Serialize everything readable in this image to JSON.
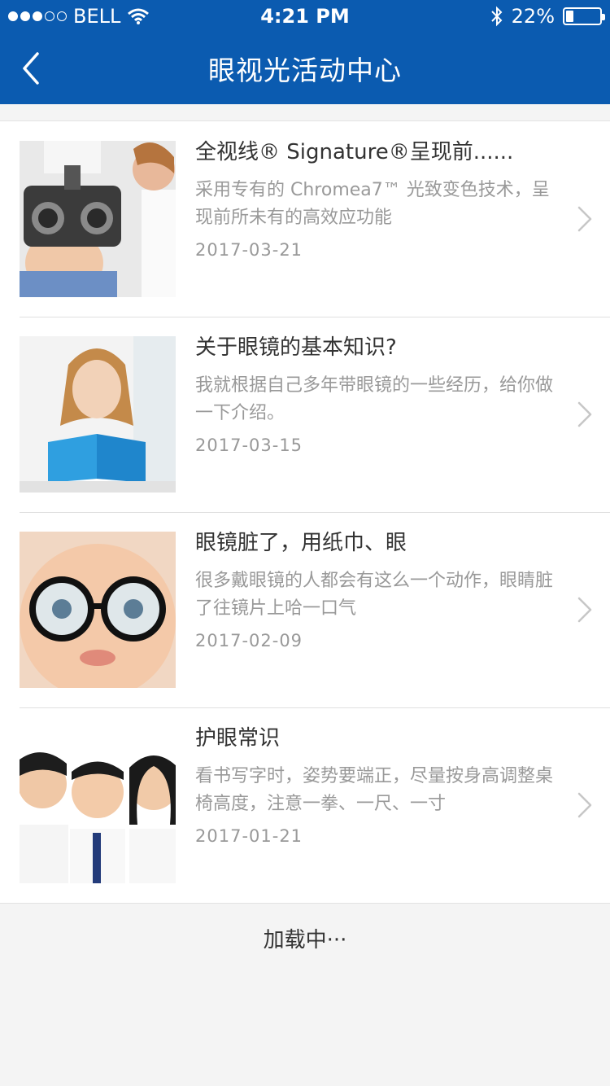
{
  "status": {
    "carrier": "BELL",
    "time": "4:21 PM",
    "battery": "22%",
    "battery_level": 0.22
  },
  "nav": {
    "title": "眼视光活动中心"
  },
  "articles": [
    {
      "title": "全视线® Signature®呈现前......",
      "desc": "采用专有的 Chromea7™ 光致变色技术，呈现前所未有的高效应功能",
      "date": "2017-03-21"
    },
    {
      "title": "关于眼镜的基本知识?",
      "desc": "我就根据自己多年带眼镜的一些经历，给你做一下介绍。",
      "date": "2017-03-15"
    },
    {
      "title": "眼镜脏了，用纸巾、眼",
      "desc": "很多戴眼镜的人都会有这么一个动作，眼睛脏了往镜片上哈一口气",
      "date": "2017-02-09"
    },
    {
      "title": "护眼常识",
      "desc": "看书写字时，姿势要端正，尽量按身高调整桌椅高度，注意一拳、一尺、一寸",
      "date": "2017-01-21"
    }
  ],
  "loading_text": "加载中···",
  "colors": {
    "header_bg": "#0b5bb0",
    "muted_text": "#999999"
  }
}
